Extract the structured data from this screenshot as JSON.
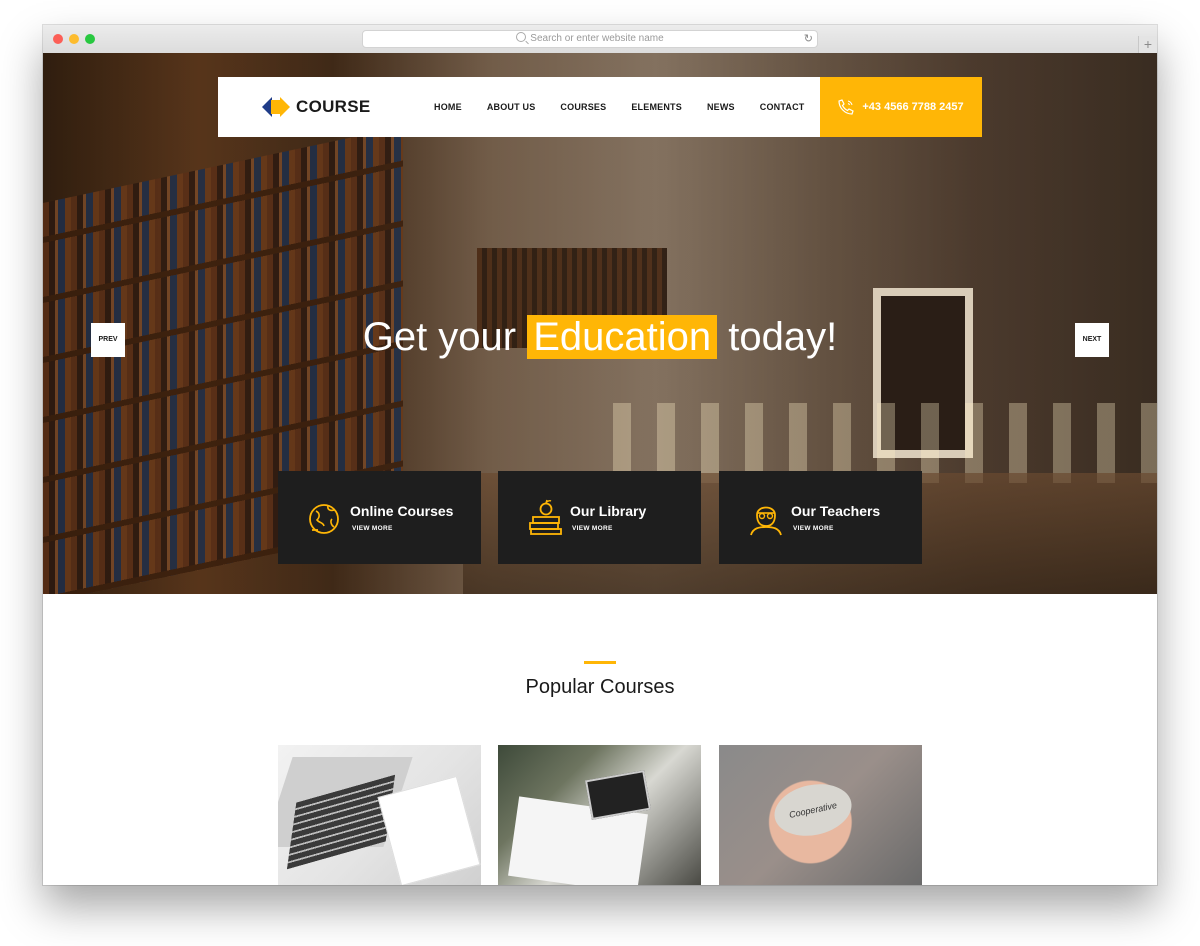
{
  "browser": {
    "address_placeholder": "Search or enter website name",
    "new_tab_symbol": "+",
    "reload_symbol": "↻"
  },
  "brand": {
    "name": "COURSE",
    "accent_color": "#ffb606",
    "logo_blue": "#1f3c88",
    "dark_color": "#1e1e1e"
  },
  "nav": {
    "items": [
      "HOME",
      "ABOUT US",
      "COURSES",
      "ELEMENTS",
      "NEWS",
      "CONTACT"
    ],
    "phone": "+43 4566 7788 2457",
    "phone_icon": "phone-icon"
  },
  "hero": {
    "headline_before": "Get your",
    "headline_highlight": "Education",
    "headline_after": "today!",
    "prev_label": "PREV",
    "next_label": "NEXT"
  },
  "features": [
    {
      "title": "Online Courses",
      "link": "VIEW MORE",
      "icon": "globe-icon"
    },
    {
      "title": "Our Library",
      "link": "VIEW MORE",
      "icon": "books-icon"
    },
    {
      "title": "Our Teachers",
      "link": "VIEW MORE",
      "icon": "teacher-icon"
    }
  ],
  "popular": {
    "title": "Popular Courses",
    "stone_text": "Cooperative"
  }
}
